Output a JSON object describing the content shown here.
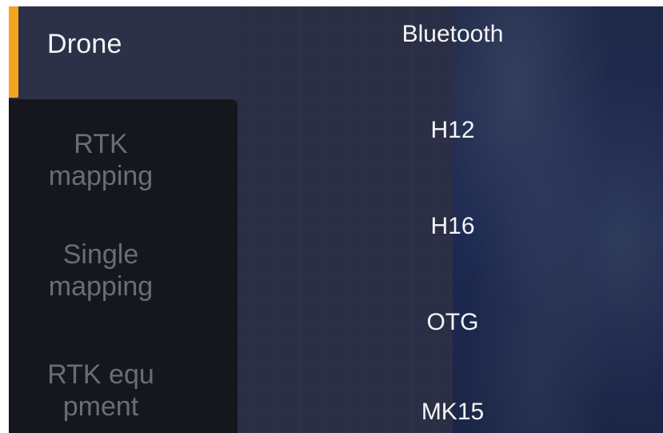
{
  "sidebar": {
    "active_tab": "Drone",
    "tabs": [
      {
        "line1": "RTK",
        "line2": "mapping"
      },
      {
        "line1": "Single",
        "line2": "mapping"
      },
      {
        "line1": "RTK equ",
        "line2": "pment"
      }
    ],
    "accent_color": "#f2a51d"
  },
  "devices": [
    "Bluetooth",
    "H12",
    "H16",
    "OTG",
    "MK15"
  ]
}
